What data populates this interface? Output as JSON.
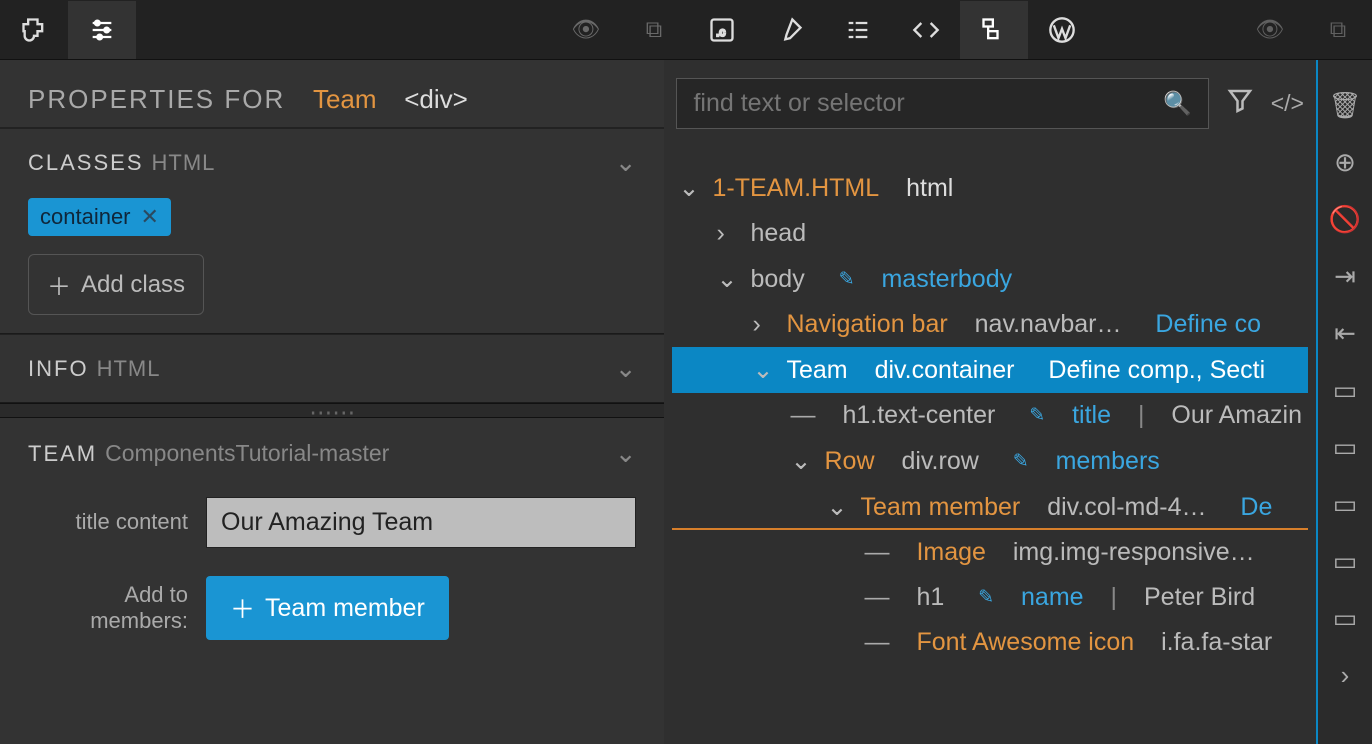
{
  "topbar": {
    "dim_icons_right2": true
  },
  "props": {
    "label": "PROPERTIES FOR",
    "element_name": "Team",
    "element_tag": "<div>"
  },
  "classes": {
    "title": "CLASSES",
    "sub": "HTML",
    "tag": "container",
    "add_label": "Add class"
  },
  "info": {
    "title": "INFO",
    "sub": "HTML"
  },
  "team": {
    "title": "TEAM",
    "sub": "ComponentsTutorial-master",
    "title_content_label": "title content",
    "title_content_value": "Our Amazing Team",
    "add_to_label": "Add to members:",
    "add_member_btn": "Team member"
  },
  "search": {
    "placeholder": "find text or selector"
  },
  "tree": {
    "file": "1-TEAM.HTML",
    "file_tag": "html",
    "head": "head",
    "body": "body",
    "body_id": "masterbody",
    "nav_label": "Navigation bar",
    "nav_sel": "nav.navbar…",
    "nav_action": "Define co",
    "team_label": "Team",
    "team_sel": "div.container",
    "team_action": "Define comp., Secti",
    "h1_sel": "h1.text-center",
    "h1_prop": "title",
    "h1_val": "Our Amazin",
    "row_label": "Row",
    "row_sel": "div.row",
    "row_prop": "members",
    "tm_label": "Team member",
    "tm_sel": "div.col-md-4…",
    "tm_action": "De",
    "img_label": "Image",
    "img_sel": "img.img-responsive…",
    "h1b_sel": "h1",
    "h1b_prop": "name",
    "h1b_val": "Peter Bird",
    "fa_label": "Font Awesome icon",
    "fa_sel": "i.fa.fa-star"
  }
}
